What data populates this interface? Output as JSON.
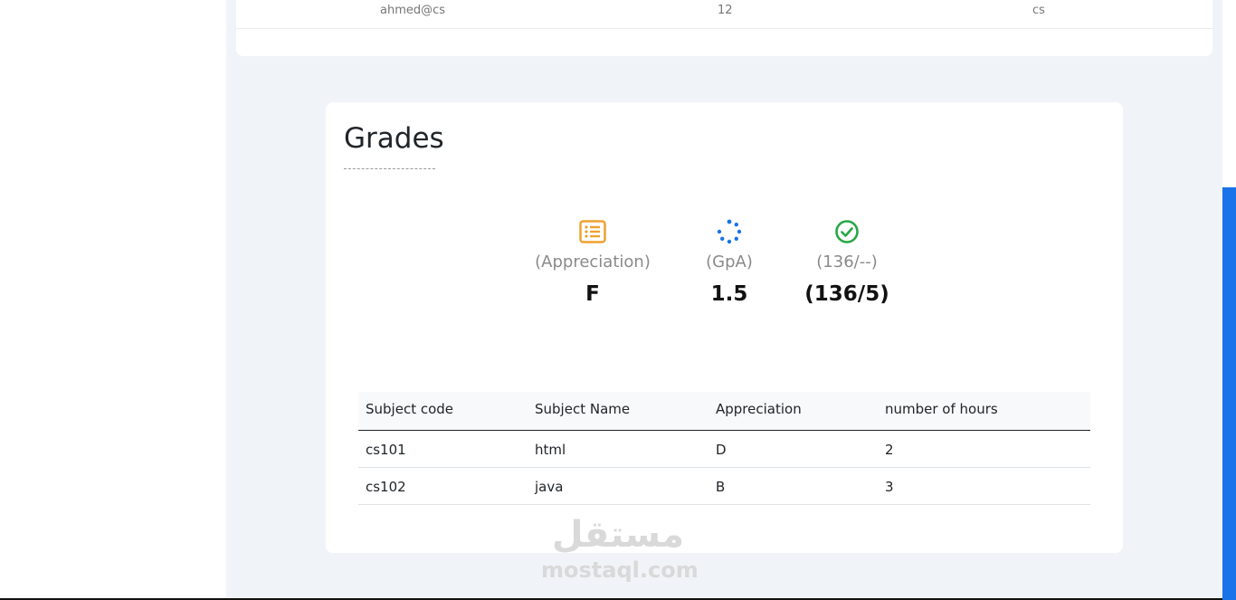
{
  "top_table": {
    "row": {
      "email": "ahmed@cs",
      "level": "12",
      "department": "cs"
    }
  },
  "grades": {
    "title": "Grades",
    "stats": [
      {
        "icon": "list-alt-icon",
        "label": "(Appreciation)",
        "value": "F",
        "icon_color": "#f0a030"
      },
      {
        "icon": "spinner-icon",
        "label": "(GpA)",
        "value": "1.5",
        "icon_color": "#1a73e8"
      },
      {
        "icon": "check-circle-icon",
        "label": "(136/--)",
        "value": "(136/5)",
        "icon_color": "#28a745"
      }
    ],
    "table": {
      "headers": [
        "Subject code",
        "Subject Name",
        "Appreciation",
        "number of hours"
      ],
      "rows": [
        [
          "cs101",
          "html",
          "D",
          "2"
        ],
        [
          "cs102",
          "java",
          "B",
          "3"
        ]
      ]
    }
  },
  "watermark": {
    "arabic": "مستقل",
    "latin": "mostaql.com"
  },
  "colors": {
    "accent": "#1a73e8",
    "page_bg": "#f0f3f7",
    "card_bg": "#ffffff"
  }
}
